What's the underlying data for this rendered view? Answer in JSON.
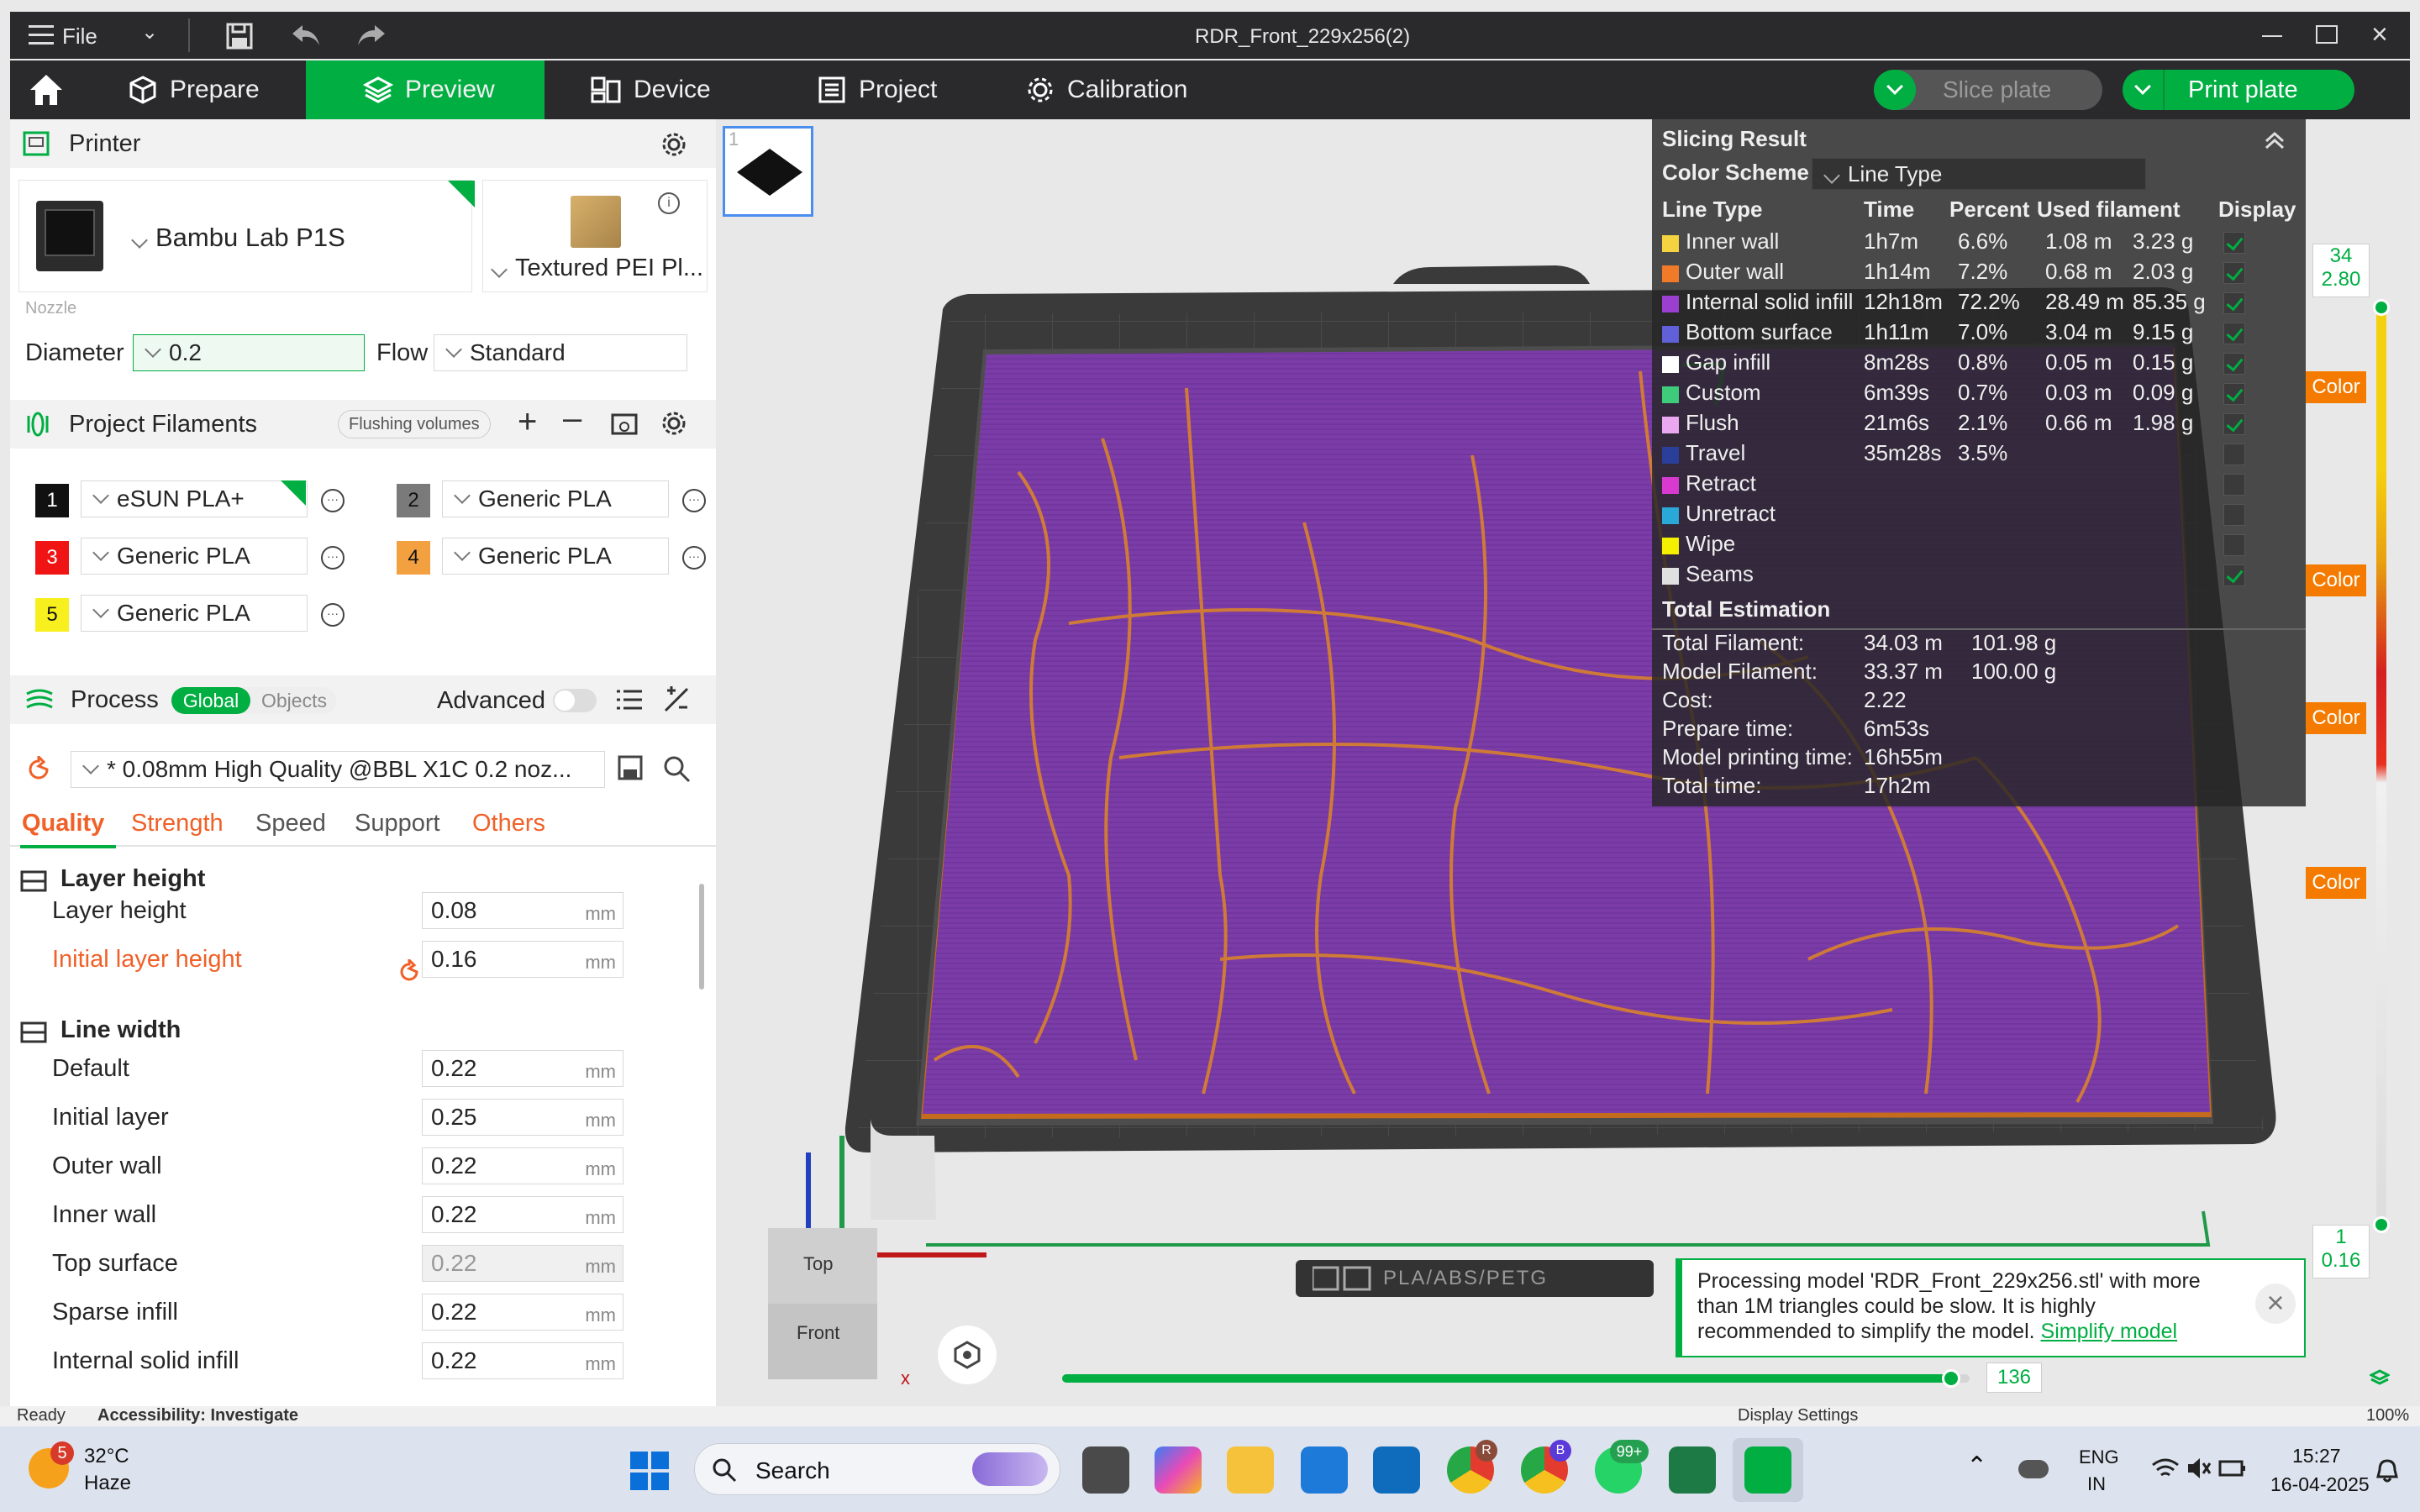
{
  "window": {
    "title": "RDR_Front_229x256(2)",
    "menu_label": "File"
  },
  "nav": {
    "tabs": [
      {
        "label": "Prepare"
      },
      {
        "label": "Preview"
      },
      {
        "label": "Device"
      },
      {
        "label": "Project"
      },
      {
        "label": "Calibration"
      }
    ],
    "slice_label": "Slice plate",
    "print_label": "Print plate"
  },
  "printer": {
    "section_title": "Printer",
    "printer_name": "Bambu Lab P1S",
    "plate_name": "Textured PEI Pl...",
    "nozzle_label": "Nozzle",
    "diameter_label": "Diameter",
    "diameter_value": "0.2",
    "flow_label": "Flow",
    "flow_value": "Standard"
  },
  "filaments": {
    "section_title": "Project Filaments",
    "flushing_label": "Flushing volumes",
    "items": [
      {
        "num": "1",
        "name": "eSUN PLA+",
        "color": "#111111",
        "text_color": "#ffffff"
      },
      {
        "num": "2",
        "name": "Generic PLA",
        "color": "#7a7a7a",
        "text_color": "#111111"
      },
      {
        "num": "3",
        "name": "Generic PLA",
        "color": "#f01414",
        "text_color": "#ffffff"
      },
      {
        "num": "4",
        "name": "Generic PLA",
        "color": "#f2a040",
        "text_color": "#111111"
      },
      {
        "num": "5",
        "name": "Generic PLA",
        "color": "#f7f01e",
        "text_color": "#111111"
      }
    ]
  },
  "process": {
    "section_title": "Process",
    "global_label": "Global",
    "objects_label": "Objects",
    "advanced_label": "Advanced",
    "preset": "* 0.08mm High Quality @BBL X1C 0.2 noz...",
    "tabs": [
      "Quality",
      "Strength",
      "Speed",
      "Support",
      "Others"
    ],
    "layer_height_group": "Layer height",
    "line_width_group": "Line width",
    "unit": "mm",
    "settings": [
      {
        "label": "Layer height",
        "value": "0.08"
      },
      {
        "label": "Initial layer height",
        "value": "0.16"
      },
      {
        "label": "Default",
        "value": "0.22"
      },
      {
        "label": "Initial layer",
        "value": "0.25"
      },
      {
        "label": "Outer wall",
        "value": "0.22"
      },
      {
        "label": "Inner wall",
        "value": "0.22"
      },
      {
        "label": "Top surface",
        "value": "0.22"
      },
      {
        "label": "Sparse infill",
        "value": "0.22"
      },
      {
        "label": "Internal solid infill",
        "value": "0.22"
      }
    ]
  },
  "slicing": {
    "title": "Slicing Result",
    "scheme_label": "Color Scheme",
    "scheme_value": "Line Type",
    "headers": [
      "Line Type",
      "Time",
      "Percent",
      "Used filament",
      "Display"
    ],
    "rows": [
      {
        "name": "Inner wall",
        "time": "1h7m",
        "percent": "6.6%",
        "len": "1.08 m",
        "weight": "3.23 g",
        "color": "#f5d240",
        "on": true
      },
      {
        "name": "Outer wall",
        "time": "1h14m",
        "percent": "7.2%",
        "len": "0.68 m",
        "weight": "2.03 g",
        "color": "#f07a28",
        "on": true
      },
      {
        "name": "Internal solid infill",
        "time": "12h18m",
        "percent": "72.2%",
        "len": "28.49 m",
        "weight": "85.35 g",
        "color": "#9a3fd0",
        "on": true
      },
      {
        "name": "Bottom surface",
        "time": "1h11m",
        "percent": "7.0%",
        "len": "3.04 m",
        "weight": "9.15 g",
        "color": "#6060d8",
        "on": true
      },
      {
        "name": "Gap infill",
        "time": "8m28s",
        "percent": "0.8%",
        "len": "0.05 m",
        "weight": "0.15 g",
        "color": "#ffffff",
        "on": true
      },
      {
        "name": "Custom",
        "time": "6m39s",
        "percent": "0.7%",
        "len": "0.03 m",
        "weight": "0.09 g",
        "color": "#3ecb7a",
        "on": true
      },
      {
        "name": "Flush",
        "time": "21m6s",
        "percent": "2.1%",
        "len": "0.66 m",
        "weight": "1.98 g",
        "color": "#e9a8f0",
        "on": true
      },
      {
        "name": "Travel",
        "time": "35m28s",
        "percent": "3.5%",
        "len": "",
        "weight": "",
        "color": "#2a3f9a",
        "on": false
      },
      {
        "name": "Retract",
        "time": "",
        "percent": "",
        "len": "",
        "weight": "",
        "color": "#d83ad0",
        "on": false
      },
      {
        "name": "Unretract",
        "time": "",
        "percent": "",
        "len": "",
        "weight": "",
        "color": "#2aa8d8",
        "on": false
      },
      {
        "name": "Wipe",
        "time": "",
        "percent": "",
        "len": "",
        "weight": "",
        "color": "#f5f000",
        "on": false
      },
      {
        "name": "Seams",
        "time": "",
        "percent": "",
        "len": "",
        "weight": "",
        "color": "#e0e0e0",
        "on": true
      }
    ],
    "total_title": "Total Estimation",
    "totals": [
      {
        "label": "Total Filament:",
        "v1": "34.03 m",
        "v2": "101.98 g"
      },
      {
        "label": "Model Filament:",
        "v1": "33.37 m",
        "v2": "100.00 g"
      },
      {
        "label": "Cost:",
        "v1": "2.22",
        "v2": ""
      },
      {
        "label": "Prepare time:",
        "v1": "6m53s",
        "v2": ""
      },
      {
        "label": "Model printing time:",
        "v1": "16h55m",
        "v2": ""
      },
      {
        "label": "Total time:",
        "v1": "17h2m",
        "v2": ""
      }
    ]
  },
  "slider": {
    "top_layer": "34",
    "top_height": "2.80",
    "bottom_layer": "1",
    "bottom_height": "0.16",
    "color_label": "Color",
    "move_value": "136",
    "move_fraction": 0.98
  },
  "viewport": {
    "plate_badge": "PLA/ABS/PETG",
    "plate_number": "1",
    "cube_top": "Top",
    "cube_front": "Front",
    "axis_x": "x"
  },
  "notification": {
    "text": "Processing model 'RDR_Front_229x256.stl' with more than 1M triangles could be slow. It is highly recommended to simplify the model.",
    "link": "Simplify model"
  },
  "statusbar": {
    "left": "Ready",
    "accessibility": "Accessibility: Investigate",
    "display_settings": "Display Settings",
    "zoom": "100%"
  },
  "taskbar": {
    "weather_temp": "32°C",
    "weather_desc": "Haze",
    "weather_badge": "5",
    "search": "Search",
    "lang1": "ENG",
    "lang2": "IN",
    "time": "15:27",
    "date": "16-04-2025",
    "badge_chrome_r": "R",
    "badge_chrome_b": "B",
    "badge_whatsapp": "99+"
  }
}
